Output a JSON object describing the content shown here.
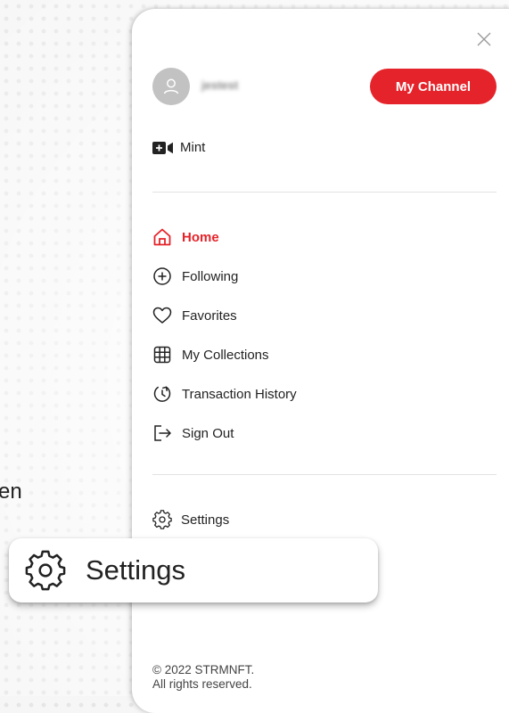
{
  "background": {
    "partial_text": "en"
  },
  "menu": {
    "user": {
      "username": "jestest"
    },
    "channel_button": "My Channel",
    "mint_label": "Mint",
    "nav": [
      {
        "label": "Home",
        "icon": "home-icon",
        "active": true
      },
      {
        "label": "Following",
        "icon": "plus-circle-icon",
        "active": false
      },
      {
        "label": "Favorites",
        "icon": "heart-icon",
        "active": false
      },
      {
        "label": "My Collections",
        "icon": "grid-icon",
        "active": false
      },
      {
        "label": "Transaction History",
        "icon": "history-icon",
        "active": false
      },
      {
        "label": "Sign Out",
        "icon": "sign-out-icon",
        "active": false
      }
    ],
    "settings_label": "Settings",
    "footer": {
      "copyright": "© 2022 STRMNFT.",
      "rights": "All rights reserved."
    }
  },
  "callout": {
    "label": "Settings"
  },
  "colors": {
    "accent": "#e5232a",
    "text": "#222222",
    "avatar": "#c2c2c2"
  }
}
